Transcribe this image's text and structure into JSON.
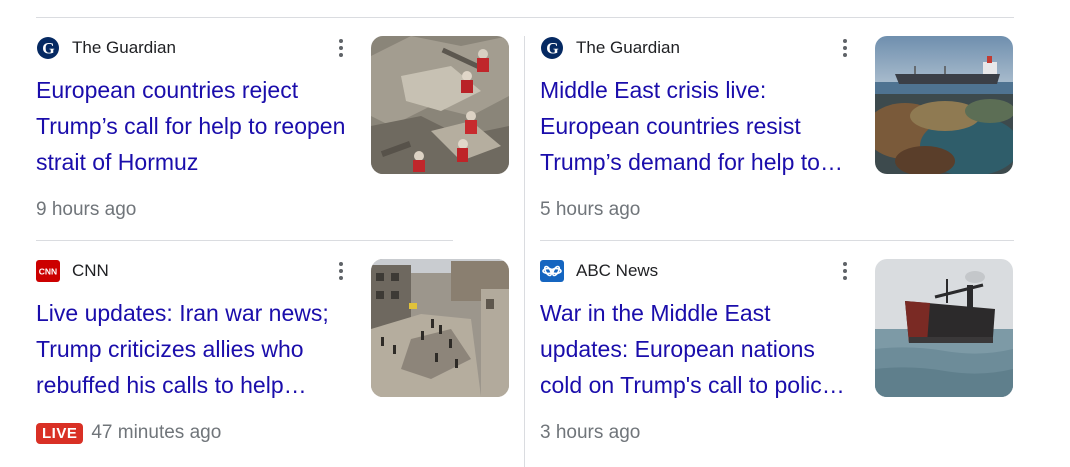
{
  "articles": [
    {
      "source": "The Guardian",
      "source_icon": "guardian-logo-icon",
      "headline": "European countries reject Trump’s call for help to reopen strait of Hormuz",
      "time": "9 hours ago",
      "live": null,
      "thumbnail": "rescue-workers-rubble-image"
    },
    {
      "source": "The Guardian",
      "source_icon": "guardian-logo-icon",
      "headline": "Middle East crisis live: European countries resist Trump’s demand for help to…",
      "time": "5 hours ago",
      "live": null,
      "thumbnail": "tanker-ship-sea-image"
    },
    {
      "source": "CNN",
      "source_icon": "cnn-logo-icon",
      "headline": "Live updates: Iran war news; Trump criticizes allies who rebuffed his calls to help…",
      "time": "47 minutes ago",
      "live": "LIVE",
      "thumbnail": "destroyed-street-image"
    },
    {
      "source": "ABC News",
      "source_icon": "abc-news-logo-icon",
      "headline": "War in the Middle East updates: European nations cold on Trump's call to polic…",
      "time": "3 hours ago",
      "live": null,
      "thumbnail": "burned-tanker-image"
    }
  ],
  "colors": {
    "headline": "#1a0dab",
    "meta": "#70757a",
    "live_badge": "#d93025",
    "divider": "#dadce0",
    "cnn_red": "#cc0000",
    "abc_blue": "#1565c0",
    "guardian_navy": "#052962"
  }
}
